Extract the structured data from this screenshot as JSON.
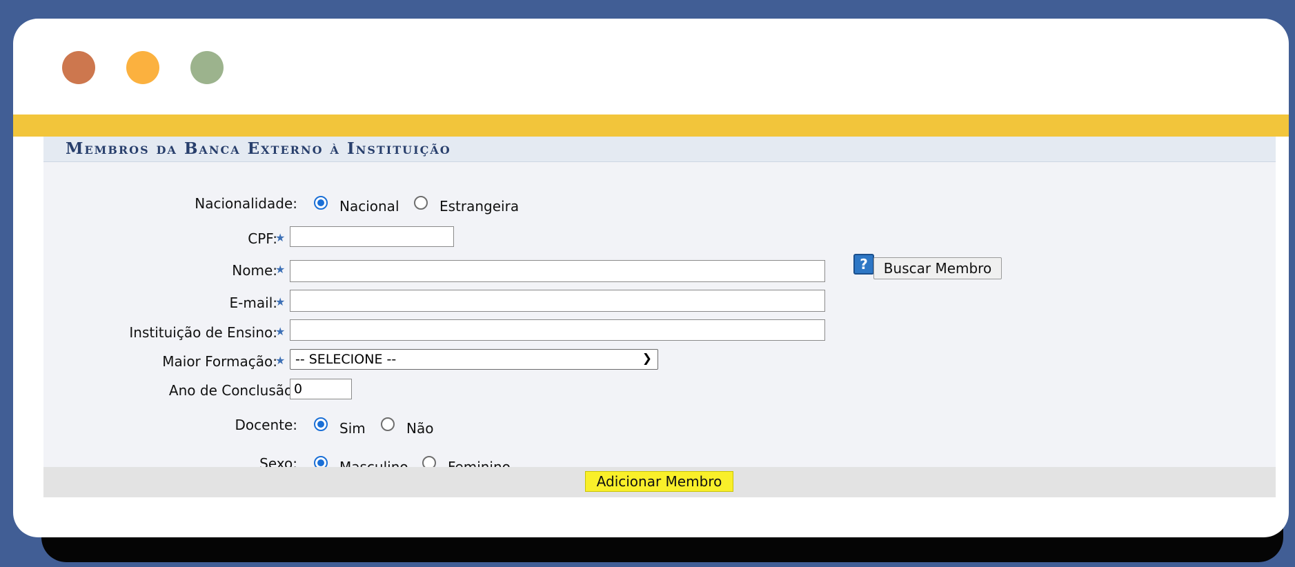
{
  "window": {
    "controls": [
      {
        "name": "close",
        "color": "#cd774e"
      },
      {
        "name": "minimize",
        "color": "#fbb13f"
      },
      {
        "name": "maximize",
        "color": "#9cb38d"
      }
    ]
  },
  "panel": {
    "title": "Membros da Banca Externo à Instituição"
  },
  "form": {
    "nacionalidade": {
      "label": "Nacionalidade:",
      "options": [
        "Nacional",
        "Estrangeira"
      ],
      "selected": "Nacional"
    },
    "cpf": {
      "label": "CPF:",
      "value": ""
    },
    "nome": {
      "label": "Nome:",
      "value": ""
    },
    "email": {
      "label": "E-mail:",
      "value": ""
    },
    "instituicao": {
      "label": "Instituição de Ensino:",
      "value": ""
    },
    "maior_formacao": {
      "label": "Maior Formação:",
      "selected": "-- SELECIONE --"
    },
    "ano_conclusao": {
      "label": "Ano de Conclusão:",
      "value": "0"
    },
    "docente": {
      "label": "Docente:",
      "options": [
        "Sim",
        "Não"
      ],
      "selected": "Sim"
    },
    "sexo": {
      "label": "Sexo:",
      "options": [
        "Masculino",
        "Feminino"
      ],
      "selected": "Masculino"
    },
    "help_icon_text": "?",
    "buscar_label": "Buscar Membro",
    "adicionar_label": "Adicionar Membro"
  }
}
